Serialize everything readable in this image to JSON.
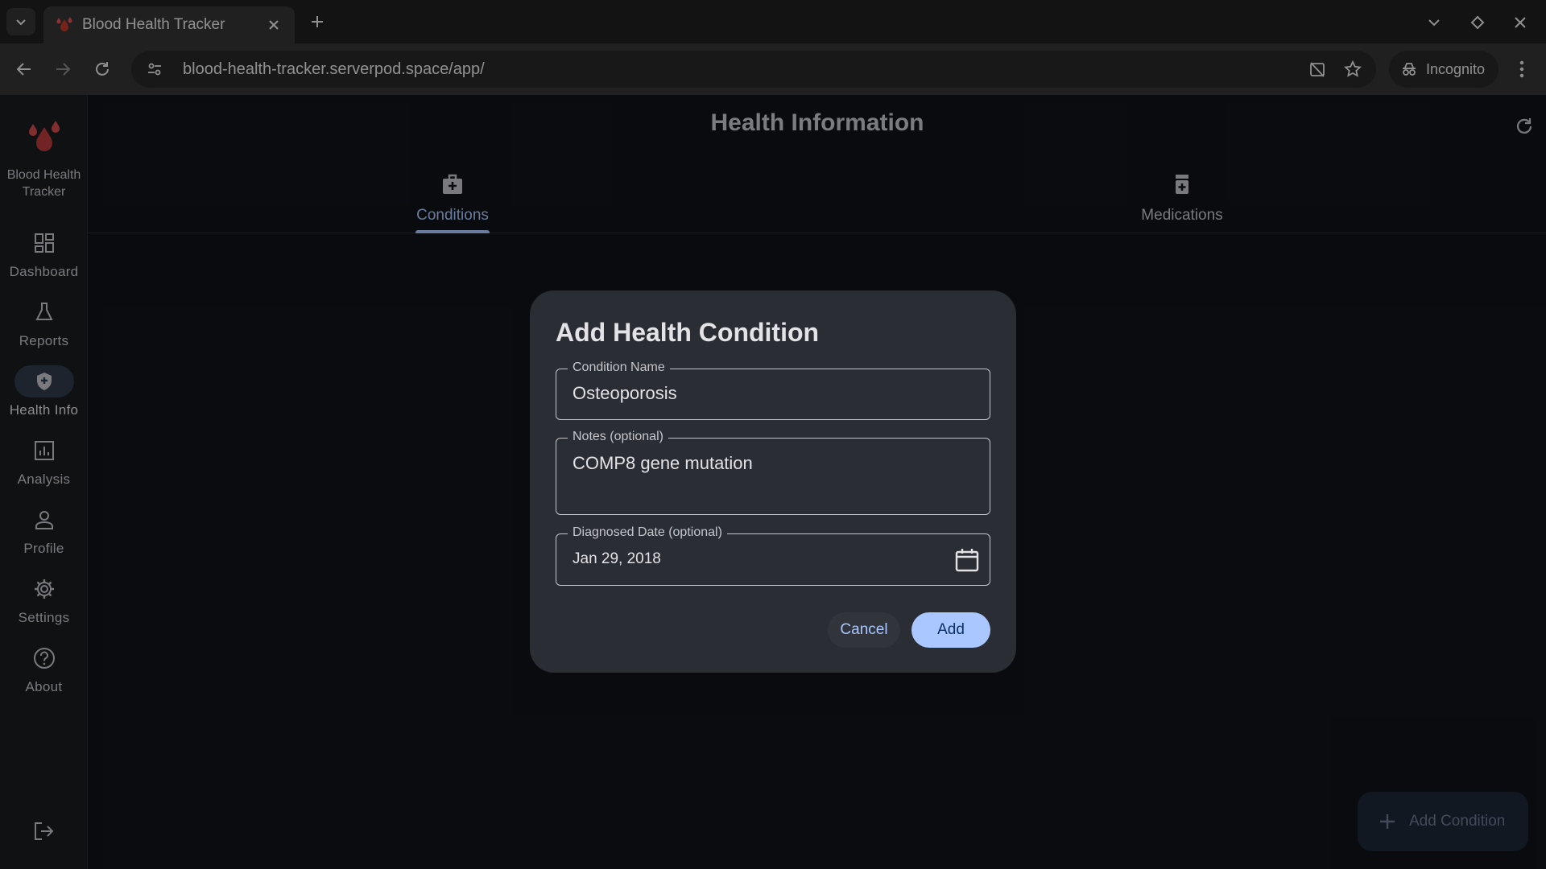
{
  "browser": {
    "tab_title": "Blood Health Tracker",
    "url": "blood-health-tracker.serverpod.space/app/",
    "incognito_label": "Incognito"
  },
  "app": {
    "brand_line1": "Blood Health",
    "brand_line2": "Tracker",
    "rail": [
      {
        "label": "Dashboard",
        "icon": "dashboard-icon"
      },
      {
        "label": "Reports",
        "icon": "flask-icon"
      },
      {
        "label": "Health Info",
        "icon": "shield-icon"
      },
      {
        "label": "Analysis",
        "icon": "chart-icon"
      },
      {
        "label": "Profile",
        "icon": "person-icon"
      },
      {
        "label": "Settings",
        "icon": "gear-icon"
      },
      {
        "label": "About",
        "icon": "help-icon"
      }
    ],
    "active_rail": "Health Info",
    "page_title": "Health Information",
    "tabs": [
      {
        "label": "Conditions",
        "icon": "medical-bag-icon"
      },
      {
        "label": "Medications",
        "icon": "pill-bottle-icon"
      }
    ],
    "active_tab": "Conditions",
    "fab_label": "Add Condition"
  },
  "dialog": {
    "title": "Add Health Condition",
    "condition_name": {
      "label": "Condition Name",
      "value": "Osteoporosis"
    },
    "notes": {
      "label": "Notes (optional)",
      "value": "COMP8 gene mutation"
    },
    "diagnosed_date": {
      "label": "Diagnosed Date (optional)",
      "value": "Jan 29, 2018"
    },
    "cancel_label": "Cancel",
    "add_label": "Add"
  },
  "colors": {
    "accent": "#aac7ff",
    "surface": "#2a2d33",
    "background": "#111318",
    "logo_red": "#c0392b"
  }
}
